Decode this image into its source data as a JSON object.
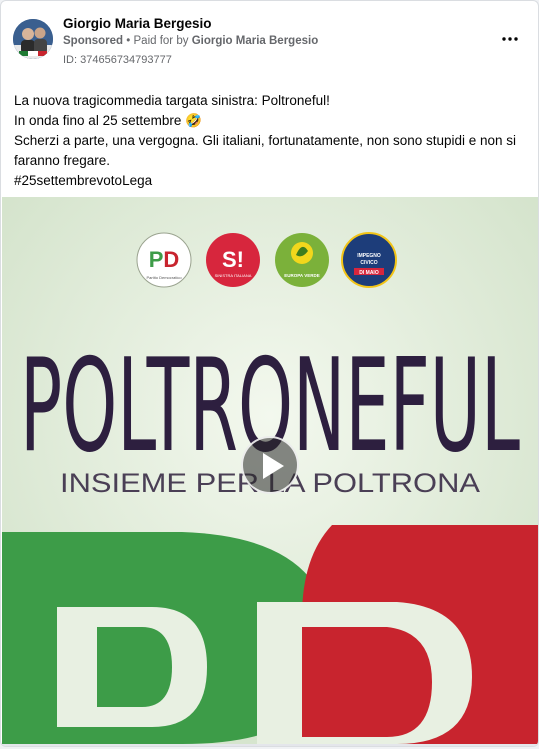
{
  "post": {
    "author": "Giorgio Maria Bergesio",
    "sponsored_label": "Sponsored",
    "paid_for_prefix": "Paid for by",
    "paid_for_name": "Giorgio Maria Bergesio",
    "separator": "•",
    "ad_id": "ID: 374656734793777",
    "more_icon": "more-horizontal-icon",
    "text_lines": [
      "La nuova tragicommedia targata sinistra: Poltroneful!",
      "In onda fino al 25 settembre 🤣",
      "Scherzi a parte, una vergogna. Gli italiani, fortunatamente, non sono stupidi e non si faranno fregare.",
      "#25settembrevotoLega"
    ]
  },
  "video": {
    "title_word": "POLTRONEFUL",
    "subtitle": "INSIEME PER LA POLTRONA",
    "logos": [
      {
        "name": "pd-logo",
        "text": "PD",
        "sub": "Partito Democratico",
        "color": "#ffffff"
      },
      {
        "name": "si-logo",
        "text": "S!",
        "sub": "SINISTRA ITALIANA",
        "color": "#d7263d"
      },
      {
        "name": "europa-verde-logo",
        "text": "",
        "sub": "EUROPA VERDE",
        "color": "#7bb13a"
      },
      {
        "name": "impegno-civico-logo",
        "text": "",
        "sub": "IMPEGNO CIVICO DI MAIO",
        "color": "#1d3d7a"
      }
    ],
    "play_icon": "play-icon",
    "colors": {
      "background": "#e8f0e2",
      "title": "#2d1f3f",
      "green": "#3d9c48",
      "red": "#c8242e"
    }
  }
}
